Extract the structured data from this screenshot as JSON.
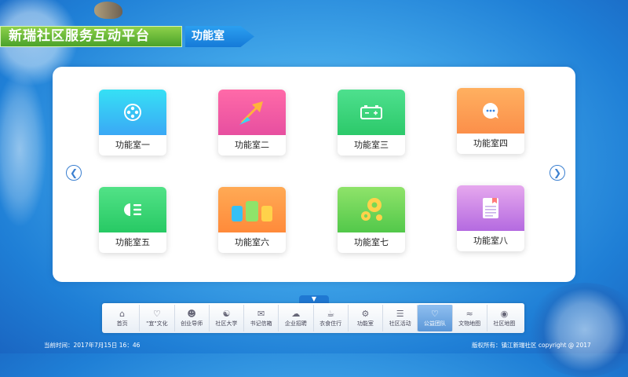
{
  "header": {
    "title": "新瑞社区服务互动平台",
    "breadcrumb": "功能室"
  },
  "rooms": [
    {
      "label": "功能室一",
      "icon": "film-reel-icon"
    },
    {
      "label": "功能室二",
      "icon": "swap-arrows-icon"
    },
    {
      "label": "功能室三",
      "icon": "battery-icon"
    },
    {
      "label": "功能室四",
      "icon": "chat-bubble-icon"
    },
    {
      "label": "功能室五",
      "icon": "headlight-icon"
    },
    {
      "label": "功能室六",
      "icon": "group-people-icon"
    },
    {
      "label": "功能室七",
      "icon": "gears-icon"
    },
    {
      "label": "功能室八",
      "icon": "document-icon"
    }
  ],
  "nav": [
    {
      "label": "首页",
      "icon": "home-icon"
    },
    {
      "label": "\"宜\"文化",
      "icon": "heart-hand-icon"
    },
    {
      "label": "创业导师",
      "icon": "mentor-icon"
    },
    {
      "label": "社区大学",
      "icon": "university-icon"
    },
    {
      "label": "书记信箱",
      "icon": "mailbox-icon"
    },
    {
      "label": "企业招聘",
      "icon": "cloud-icon"
    },
    {
      "label": "衣食住行",
      "icon": "cup-icon"
    },
    {
      "label": "功能室",
      "icon": "gear-icon"
    },
    {
      "label": "社区活动",
      "icon": "list-icon"
    },
    {
      "label": "公益团队",
      "icon": "heart-icon",
      "active": true
    },
    {
      "label": "文物地图",
      "icon": "cloud-wave-icon"
    },
    {
      "label": "社区地图",
      "icon": "map-pin-icon"
    }
  ],
  "footer": {
    "time": "当前时间：2017年7月15日 16：46",
    "copyright": "版权所有：镇江新瑞社区 copyright @ 2017"
  }
}
